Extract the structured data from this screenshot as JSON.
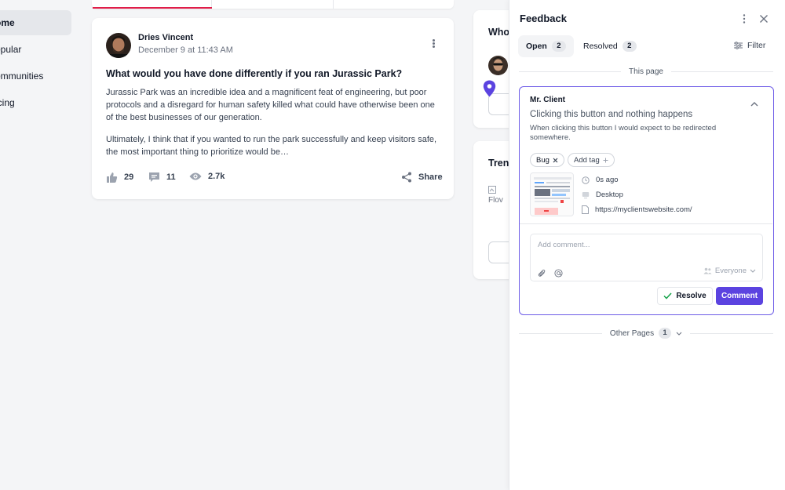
{
  "nav": {
    "items": [
      {
        "label": "ome",
        "active": true
      },
      {
        "label": "opular",
        "active": false
      },
      {
        "label": "ommunities",
        "active": false
      },
      {
        "label": "icing",
        "active": false
      }
    ]
  },
  "post": {
    "author": "Dries Vincent",
    "date": "December 9 at 11:43 AM",
    "title": "What would you have done differently if you ran Jurassic Park?",
    "body1": "Jurassic Park was an incredible idea and a magnificent feat of engineering, but poor protocols and a disregard for human safety killed what could have otherwise been one of the best businesses of our generation.",
    "body2": "Ultimately, I think that if you wanted to run the park successfully and keep visitors safe, the most important thing to prioritize would be…",
    "likes": "29",
    "comments": "11",
    "views": "2.7k",
    "share_label": "Share"
  },
  "side": {
    "card1_title": "Who",
    "card2_title": "Tren",
    "broken_image_alt": "Flov"
  },
  "feedback": {
    "title": "Feedback",
    "tabs": [
      {
        "label": "Open",
        "count": "2",
        "active": true
      },
      {
        "label": "Resolved",
        "count": "2",
        "active": false
      }
    ],
    "filter_label": "Filter",
    "section_label": "This page",
    "item": {
      "client": "Mr. Client",
      "subject": "Clicking this button and nothing happens",
      "description": "When clicking this button I would expect to be redirected somewhere.",
      "tag": "Bug",
      "add_tag_label": "Add tag",
      "time": "0s ago",
      "device": "Desktop",
      "url": "https://myclientswebsite.com/"
    },
    "comment_placeholder": "Add comment...",
    "visibility": "Everyone",
    "resolve_label": "Resolve",
    "comment_label": "Comment",
    "other_pages_label": "Other Pages",
    "other_pages_count": "1"
  },
  "colors": {
    "accent": "#5b43e0",
    "card_border": "#6d5ce7",
    "tab_underline": "#e11d48",
    "pin": "#5b43e0"
  }
}
